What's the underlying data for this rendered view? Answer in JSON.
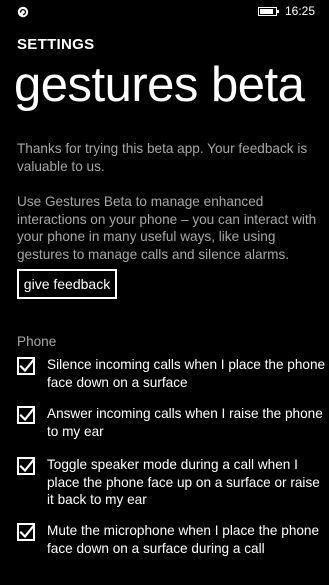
{
  "status_bar": {
    "app_icon": "refresh-app-icon",
    "battery_icon": "battery-icon",
    "time": "16:25"
  },
  "header": {
    "section_title": "SETTINGS",
    "page_title": "gestures beta"
  },
  "intro": {
    "paragraph_1": "Thanks for trying this beta app. Your feedback is valuable to us.",
    "paragraph_2": "Use Gestures Beta to manage enhanced interactions on your phone – you can interact with your phone in many useful ways, like using gestures to manage calls and silence alarms."
  },
  "feedback_button": {
    "label": "give feedback"
  },
  "phone_group": {
    "label": "Phone",
    "items": [
      {
        "label": "Silence incoming calls when I place the phone face down on a surface",
        "checked": true
      },
      {
        "label": "Answer incoming calls when I raise the phone to my ear",
        "checked": true
      },
      {
        "label": "Toggle speaker mode during a call when I place the phone face up on a surface or raise it back to my ear",
        "checked": true
      },
      {
        "label": "Mute the microphone when I place the phone face down on a surface during a call",
        "checked": true
      }
    ]
  },
  "colors": {
    "background": "#000000",
    "foreground": "#ffffff",
    "secondary_text": "#a6a6a6"
  }
}
